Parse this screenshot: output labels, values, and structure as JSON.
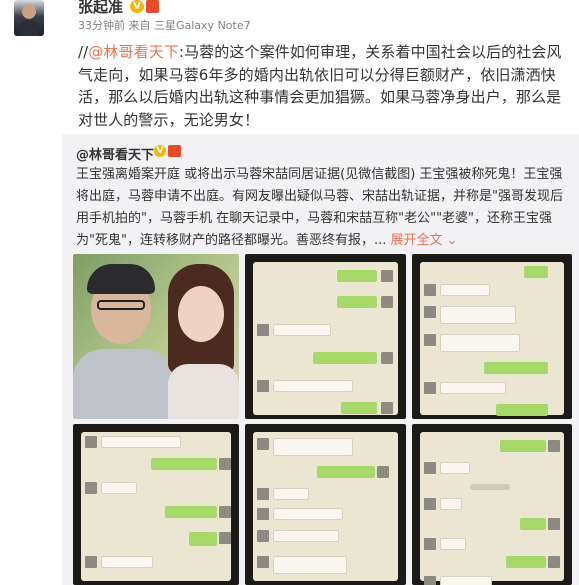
{
  "post": {
    "author": "张起准",
    "verified_mark": "V",
    "meta": "33分钟前 来自 三星Galaxy Note7",
    "text_prefix": "//",
    "mention": "@林哥看天下",
    "text_body": ":马蓉的这个案件如何审理，关系着中国社会以后的社会风气走向，如果马蓉6年多的婚内出轨依旧可以分得巨额财产，依旧潇洒快活，那么以后婚内出轨这种事情会更加猖獗。如果马蓉净身出户，那么是对世人的警示，无论男女！"
  },
  "repost": {
    "author": "@林哥看天下",
    "verified_mark": "V",
    "text": "王宝强离婚案开庭 或将出示马蓉宋喆同居证据(见微信截图) 王宝强被称死鬼！王宝强将出庭，马蓉申请不出庭。有网友曝出疑似马蓉、宋喆出轨证据，并称是\"强哥发现后用手机拍的\"，马蓉手机 在聊天记录中，马蓉和宋喆互称\"老公\"\"老婆\"，还称王宝强为\"死鬼\"，连转移财产的路径都曝光。善恶终有报，... ",
    "expand_label": "展开全文 ⌄"
  },
  "icons": {
    "avatar": "avatar-photo",
    "verified": "verified-badge-icon",
    "vip": "vip-badge-icon"
  },
  "colors": {
    "mention": "#eb7350",
    "repost_bg": "#f2f2f5",
    "chat_bubble": "#a6d86a"
  }
}
